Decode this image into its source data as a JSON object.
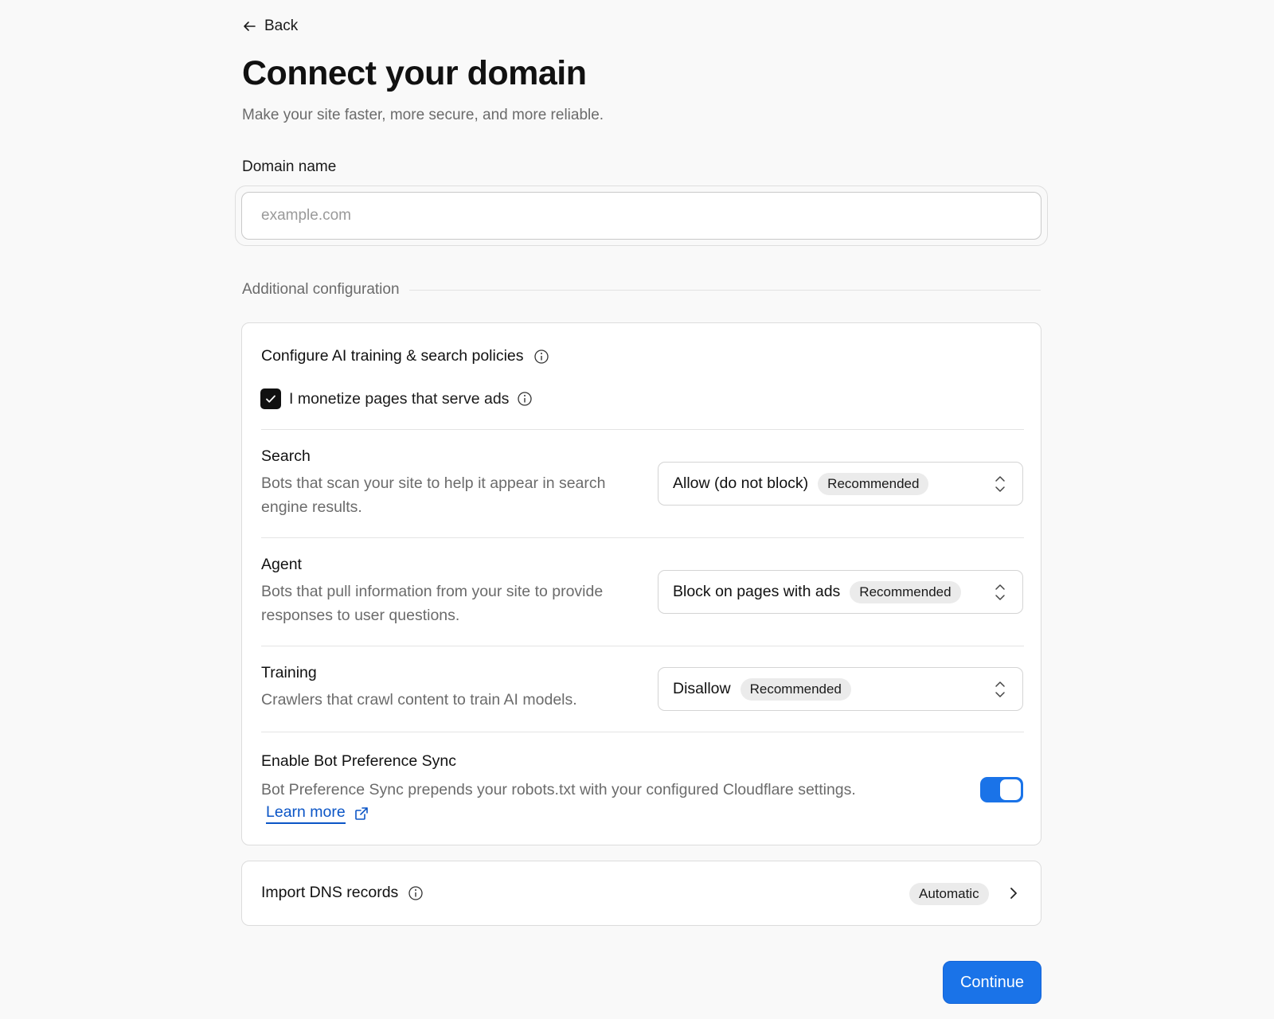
{
  "nav": {
    "back_label": "Back"
  },
  "header": {
    "title": "Connect your domain",
    "subtitle": "Make your site faster, more secure, and more reliable."
  },
  "domain": {
    "label": "Domain name",
    "placeholder": "example.com",
    "value": ""
  },
  "additional": {
    "section_title": "Additional configuration",
    "ai_card": {
      "title": "Configure AI training & search policies",
      "monetize_label": "I monetize pages that serve ads",
      "monetize_checked": true,
      "rows": [
        {
          "title": "Search",
          "description": "Bots that scan your site to help it appear in search engine results.",
          "selected": "Allow (do not block)",
          "badge": "Recommended"
        },
        {
          "title": "Agent",
          "description": "Bots that pull information from your site to provide responses to user questions.",
          "selected": "Block on pages with ads",
          "badge": "Recommended"
        },
        {
          "title": "Training",
          "description": "Crawlers that crawl content to train AI models.",
          "selected": "Disallow",
          "badge": "Recommended"
        }
      ],
      "sync": {
        "title": "Enable Bot Preference Sync",
        "description": "Bot Preference Sync prepends your robots.txt with your configured Cloudflare settings.",
        "learn_more": "Learn more",
        "enabled": true
      }
    },
    "dns": {
      "title": "Import DNS records",
      "badge": "Automatic"
    }
  },
  "actions": {
    "continue_label": "Continue"
  },
  "colors": {
    "accent": "#1a73e8",
    "link": "#0b55c6",
    "badge_bg": "#ebebeb",
    "page_bg": "#f9f9f9"
  },
  "icons": {
    "back": "arrow-left-icon",
    "info": "info-icon",
    "check": "checkmark-icon",
    "select": "chevron-up-down-icon",
    "external": "external-link-icon",
    "dns_arrow": "chevron-right-icon"
  }
}
